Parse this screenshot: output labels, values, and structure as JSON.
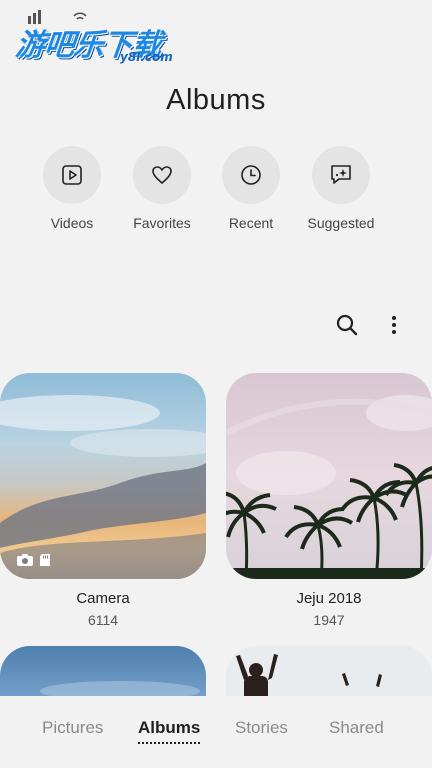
{
  "watermark": {
    "chinese_text": "游吧乐下载",
    "domain_text": "y8l.com"
  },
  "header": {
    "title": "Albums"
  },
  "quick_access": [
    {
      "label": "Videos",
      "icon": "play-icon"
    },
    {
      "label": "Favorites",
      "icon": "heart-icon"
    },
    {
      "label": "Recent",
      "icon": "clock-icon"
    },
    {
      "label": "Suggested",
      "icon": "sparkle-chat-icon"
    }
  ],
  "toolbar": {
    "search_icon": "search-icon",
    "more_icon": "more-vertical-icon"
  },
  "albums": [
    {
      "title": "Camera",
      "count": "6114"
    },
    {
      "title": "Jeju 2018",
      "count": "1947"
    }
  ],
  "bottom_nav": {
    "tabs": [
      "Pictures",
      "Albums",
      "Stories",
      "Shared"
    ],
    "active": "Albums"
  }
}
